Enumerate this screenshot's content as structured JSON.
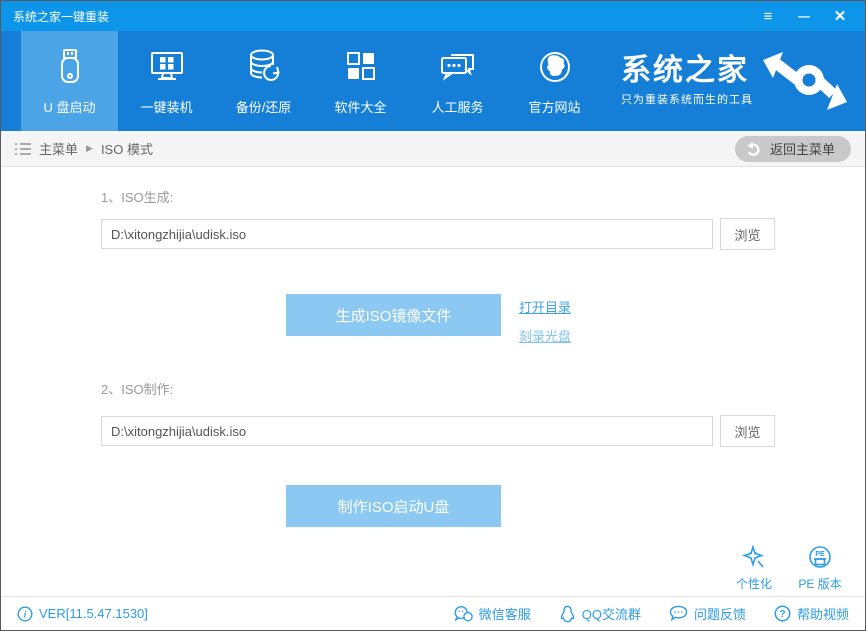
{
  "window": {
    "title": "系统之家一键重装"
  },
  "icons": {
    "menu": "≡",
    "minimize": "—",
    "close": "✕",
    "breadcrumb_arrow": "▶",
    "pe_badge": "PE",
    "info_glyph": "i",
    "help_glyph": "?"
  },
  "nav": {
    "items": [
      {
        "label": "U 盘启动"
      },
      {
        "label": "一键装机"
      },
      {
        "label": "备份/还原"
      },
      {
        "label": "软件大全"
      },
      {
        "label": "人工服务"
      },
      {
        "label": "官方网站"
      }
    ],
    "logo": {
      "brand": "系统之家",
      "tagline": "只为重装系统而生的工具"
    }
  },
  "breadcrumb": {
    "root": "主菜单",
    "current": "ISO 模式",
    "back_label": "返回主菜单"
  },
  "main": {
    "sections": [
      {
        "label": "1、ISO生成:",
        "path": "D:\\xitongzhijia\\udisk.iso",
        "browse_label": "浏览",
        "action_label": "生成ISO镜像文件",
        "links": [
          {
            "label": "打开目录"
          },
          {
            "label": "刻录光盘"
          }
        ]
      },
      {
        "label": "2、ISO制作:",
        "path": "D:\\xitongzhijia\\udisk.iso",
        "browse_label": "浏览",
        "action_label": "制作ISO启动U盘"
      }
    ],
    "corner_tools": [
      {
        "label": "个性化"
      },
      {
        "label": "PE 版本"
      }
    ]
  },
  "footer": {
    "version": "VER[11.5.47.1530]",
    "links": [
      {
        "label": "微信客服"
      },
      {
        "label": "QQ交流群"
      },
      {
        "label": "问题反馈"
      },
      {
        "label": "帮助视频"
      }
    ]
  },
  "colors": {
    "titlebar": "#0d95e9",
    "nav": "#157fd7",
    "nav_active": "#4ba4e6",
    "accent": "#2d9ce8",
    "action_button": "#8bc9f2"
  }
}
